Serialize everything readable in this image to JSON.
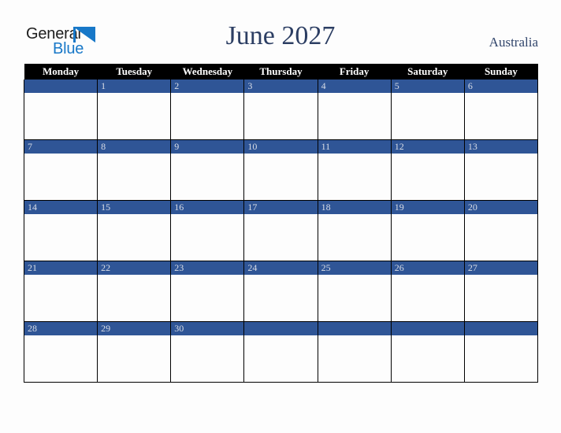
{
  "brand": {
    "name_part1": "General",
    "name_part2": "Blue",
    "triangle_color": "#1878c8",
    "text_color": "#1d1d1d"
  },
  "header": {
    "title": "June 2027",
    "country": "Australia",
    "title_color": "#2c3e63"
  },
  "calendar": {
    "month": "June",
    "year": "2027",
    "weekday_headers": [
      "Monday",
      "Tuesday",
      "Wednesday",
      "Thursday",
      "Friday",
      "Saturday",
      "Sunday"
    ],
    "header_bg": "#000000",
    "header_text_color": "#ffffff",
    "daynum_bg": "#2f5596",
    "daynum_text_color": "#d9dde6",
    "cell_bg": "#fdfdfd",
    "border_color": "#000000",
    "weeks": [
      {
        "days": [
          {
            "label": "",
            "empty": true
          },
          {
            "label": "1",
            "empty": false
          },
          {
            "label": "2",
            "empty": false
          },
          {
            "label": "3",
            "empty": false
          },
          {
            "label": "4",
            "empty": false
          },
          {
            "label": "5",
            "empty": false
          },
          {
            "label": "6",
            "empty": false
          }
        ]
      },
      {
        "days": [
          {
            "label": "7",
            "empty": false
          },
          {
            "label": "8",
            "empty": false
          },
          {
            "label": "9",
            "empty": false
          },
          {
            "label": "10",
            "empty": false
          },
          {
            "label": "11",
            "empty": false
          },
          {
            "label": "12",
            "empty": false
          },
          {
            "label": "13",
            "empty": false
          }
        ]
      },
      {
        "days": [
          {
            "label": "14",
            "empty": false
          },
          {
            "label": "15",
            "empty": false
          },
          {
            "label": "16",
            "empty": false
          },
          {
            "label": "17",
            "empty": false
          },
          {
            "label": "18",
            "empty": false
          },
          {
            "label": "19",
            "empty": false
          },
          {
            "label": "20",
            "empty": false
          }
        ]
      },
      {
        "days": [
          {
            "label": "21",
            "empty": false
          },
          {
            "label": "22",
            "empty": false
          },
          {
            "label": "23",
            "empty": false
          },
          {
            "label": "24",
            "empty": false
          },
          {
            "label": "25",
            "empty": false
          },
          {
            "label": "26",
            "empty": false
          },
          {
            "label": "27",
            "empty": false
          }
        ]
      },
      {
        "days": [
          {
            "label": "28",
            "empty": false
          },
          {
            "label": "29",
            "empty": false
          },
          {
            "label": "30",
            "empty": false
          },
          {
            "label": "",
            "empty": true
          },
          {
            "label": "",
            "empty": true
          },
          {
            "label": "",
            "empty": true
          },
          {
            "label": "",
            "empty": true
          }
        ]
      }
    ]
  }
}
